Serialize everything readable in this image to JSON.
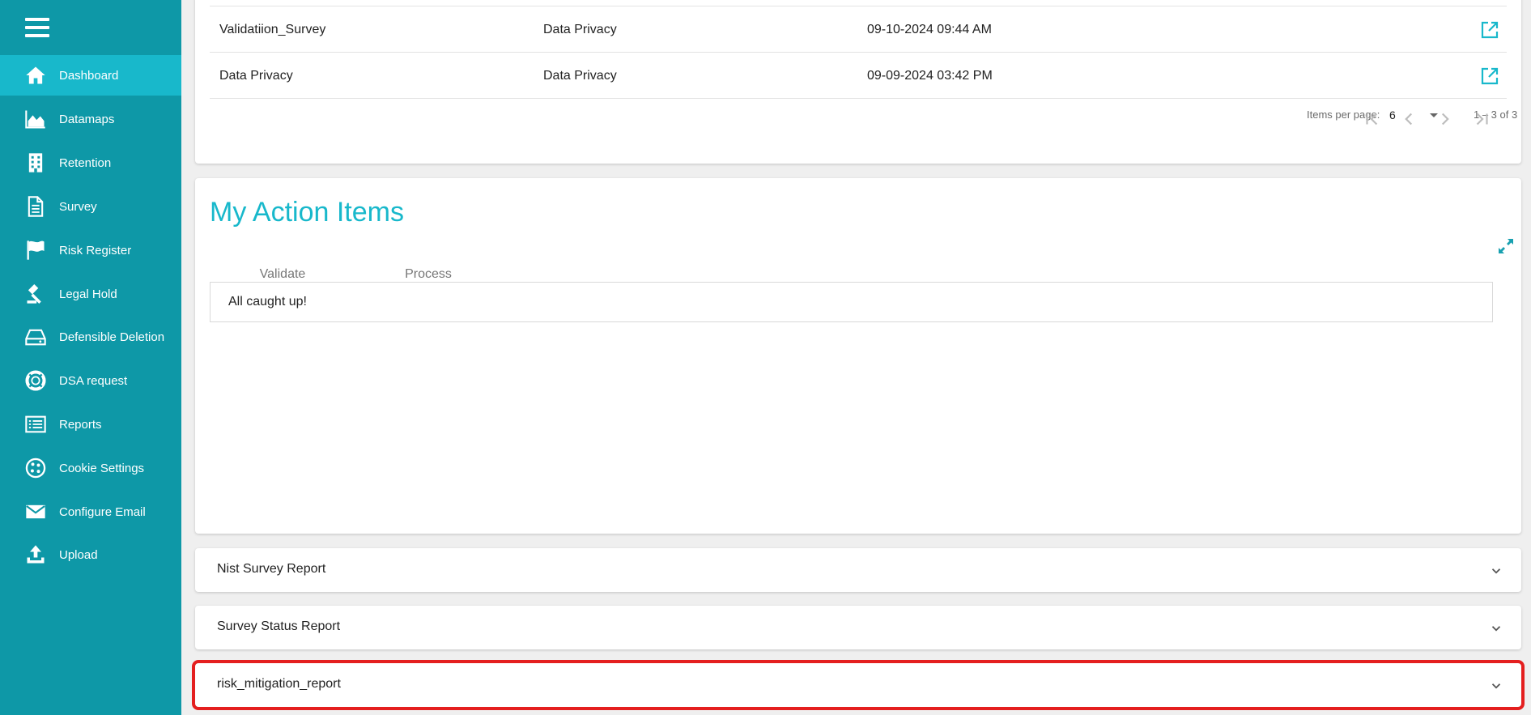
{
  "sidebar": {
    "items": [
      {
        "label": "Dashboard",
        "icon": "home-icon",
        "active": true
      },
      {
        "label": "Datamaps",
        "icon": "area-chart-icon"
      },
      {
        "label": "Retention",
        "icon": "building-icon"
      },
      {
        "label": "Survey",
        "icon": "document-icon"
      },
      {
        "label": "Risk Register",
        "icon": "flag-icon"
      },
      {
        "label": "Legal Hold",
        "icon": "gavel-icon"
      },
      {
        "label": "Defensible Deletion",
        "icon": "hard-drive-icon"
      },
      {
        "label": "DSA request",
        "icon": "lifebuoy-icon"
      },
      {
        "label": "Reports",
        "icon": "list-icon"
      },
      {
        "label": "Cookie Settings",
        "icon": "cookie-icon"
      },
      {
        "label": "Configure Email",
        "icon": "envelope-icon"
      },
      {
        "label": "Upload",
        "icon": "upload-icon"
      }
    ]
  },
  "survey_table": {
    "rows": [
      {
        "name": "Validatiion_Survey",
        "category": "Data Privacy",
        "date": "09-10-2024 09:44 AM"
      },
      {
        "name": "Data Privacy",
        "category": "Data Privacy",
        "date": "09-09-2024 03:42 PM"
      }
    ],
    "paginator": {
      "items_per_page_label": "Items per page:",
      "items_per_page_value": "6",
      "range": "1 – 3 of 3"
    }
  },
  "action_items": {
    "title": "My Action Items",
    "tabs": [
      "Validate",
      "Process"
    ],
    "empty_message": "All caught up!"
  },
  "panels": [
    {
      "title": "Nist Survey Report"
    },
    {
      "title": "Survey Status Report"
    },
    {
      "title": "risk_mitigation_report",
      "highlighted": true
    }
  ],
  "colors": {
    "sidebar_bg": "#0e98a7",
    "sidebar_active": "#18b8cb",
    "accent": "#18b8cb",
    "highlight": "#e41f1f"
  }
}
